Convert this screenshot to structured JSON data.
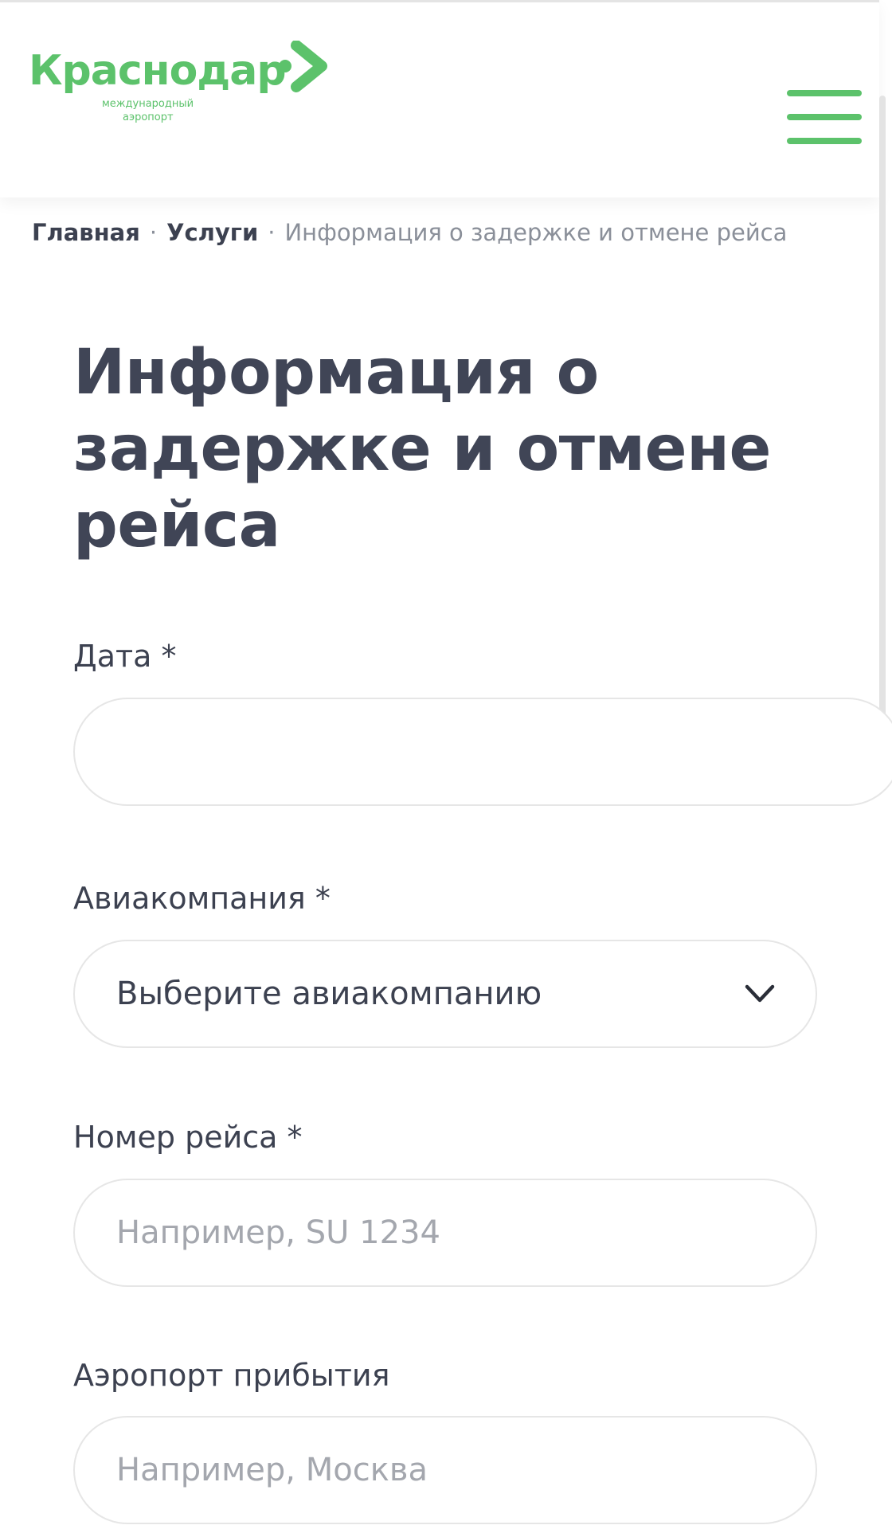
{
  "header": {
    "logo": {
      "name": "Краснодар",
      "subtitle_line1": "международный",
      "subtitle_line2": "аэропорт"
    },
    "menu_icon": "hamburger-icon"
  },
  "breadcrumb": {
    "items": [
      "Главная",
      "Услуги",
      "Информация о задержке и отмене рейса"
    ],
    "separator": "·"
  },
  "page_title": "Информация о задержке и отмене рейса",
  "form": {
    "date": {
      "label": "Дата *",
      "value": ""
    },
    "airline": {
      "label": "Авиакомпания *",
      "selected": "Выберите авиакомпанию",
      "icon": "chevron-down-icon"
    },
    "flight_number": {
      "label": "Номер рейса *",
      "placeholder": "Например, SU 1234"
    },
    "arrival_airport": {
      "label": "Аэропорт прибытия",
      "placeholder": "Например, Москва"
    }
  },
  "colors": {
    "brand_green": "#5cc26b",
    "text_dark": "#404556",
    "text_muted": "#8a8f99",
    "border": "#e6e6e6"
  }
}
